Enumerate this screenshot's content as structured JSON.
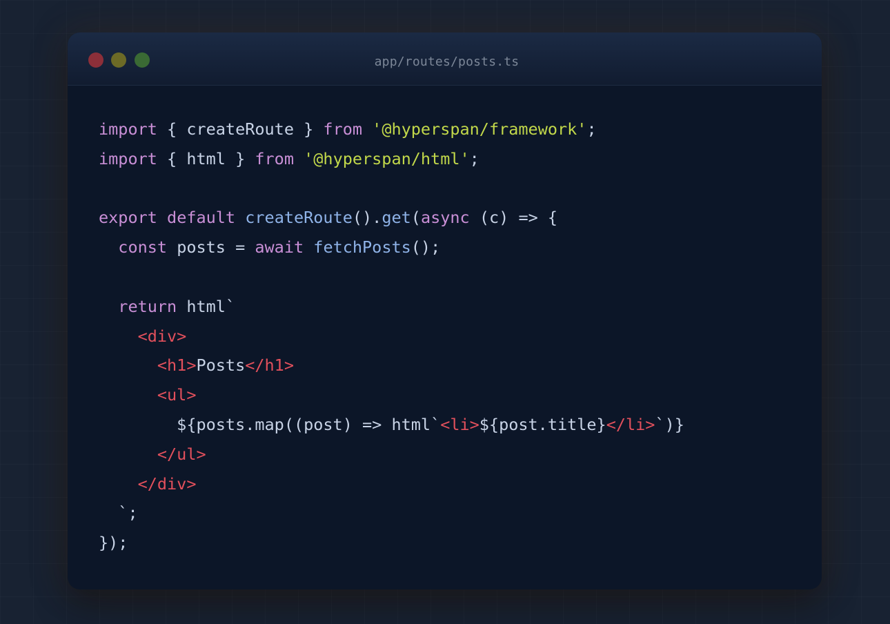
{
  "window": {
    "title": "app/routes/posts.ts"
  },
  "colors": {
    "keyword": "#c98fd6",
    "string": "#c2d84a",
    "function": "#8fb3e8",
    "tag": "#e2505c",
    "plain": "#c8d3e6",
    "background": "#0c1628",
    "close_dot": "#8c2f39",
    "minimize_dot": "#6c6a26",
    "maximize_dot": "#3a6a34"
  },
  "code_lines": [
    [
      {
        "t": "import",
        "c": "kw"
      },
      {
        "t": " { createRoute } ",
        "c": "pl"
      },
      {
        "t": "from",
        "c": "kw"
      },
      {
        "t": " ",
        "c": "pl"
      },
      {
        "t": "'@hyperspan/framework'",
        "c": "str"
      },
      {
        "t": ";",
        "c": "pl"
      }
    ],
    [
      {
        "t": "import",
        "c": "kw"
      },
      {
        "t": " { html } ",
        "c": "pl"
      },
      {
        "t": "from",
        "c": "kw"
      },
      {
        "t": " ",
        "c": "pl"
      },
      {
        "t": "'@hyperspan/html'",
        "c": "str"
      },
      {
        "t": ";",
        "c": "pl"
      }
    ],
    [],
    [
      {
        "t": "export",
        "c": "kw"
      },
      {
        "t": " ",
        "c": "pl"
      },
      {
        "t": "default",
        "c": "kw"
      },
      {
        "t": " ",
        "c": "pl"
      },
      {
        "t": "createRoute",
        "c": "fn"
      },
      {
        "t": "().",
        "c": "pl"
      },
      {
        "t": "get",
        "c": "fn"
      },
      {
        "t": "(",
        "c": "pl"
      },
      {
        "t": "async",
        "c": "kw"
      },
      {
        "t": " (c) => {",
        "c": "pl"
      }
    ],
    [
      {
        "t": "  ",
        "c": "pl"
      },
      {
        "t": "const",
        "c": "kw"
      },
      {
        "t": " posts = ",
        "c": "pl"
      },
      {
        "t": "await",
        "c": "kw"
      },
      {
        "t": " ",
        "c": "pl"
      },
      {
        "t": "fetchPosts",
        "c": "fn"
      },
      {
        "t": "();",
        "c": "pl"
      }
    ],
    [],
    [
      {
        "t": "  ",
        "c": "pl"
      },
      {
        "t": "return",
        "c": "kw"
      },
      {
        "t": " html`",
        "c": "pl"
      }
    ],
    [
      {
        "t": "    ",
        "c": "pl"
      },
      {
        "t": "<div>",
        "c": "tag"
      }
    ],
    [
      {
        "t": "      ",
        "c": "pl"
      },
      {
        "t": "<h1>",
        "c": "tag"
      },
      {
        "t": "Posts",
        "c": "pl"
      },
      {
        "t": "</h1>",
        "c": "tag"
      }
    ],
    [
      {
        "t": "      ",
        "c": "pl"
      },
      {
        "t": "<ul>",
        "c": "tag"
      }
    ],
    [
      {
        "t": "        ${posts.map((post) => html`",
        "c": "pl"
      },
      {
        "t": "<li>",
        "c": "tag"
      },
      {
        "t": "${post.title}",
        "c": "pl"
      },
      {
        "t": "</li>",
        "c": "tag"
      },
      {
        "t": "`)}",
        "c": "pl"
      }
    ],
    [
      {
        "t": "      ",
        "c": "pl"
      },
      {
        "t": "</ul>",
        "c": "tag"
      }
    ],
    [
      {
        "t": "    ",
        "c": "pl"
      },
      {
        "t": "</div>",
        "c": "tag"
      }
    ],
    [
      {
        "t": "  `;",
        "c": "pl"
      }
    ],
    [
      {
        "t": "});",
        "c": "pl"
      }
    ]
  ]
}
